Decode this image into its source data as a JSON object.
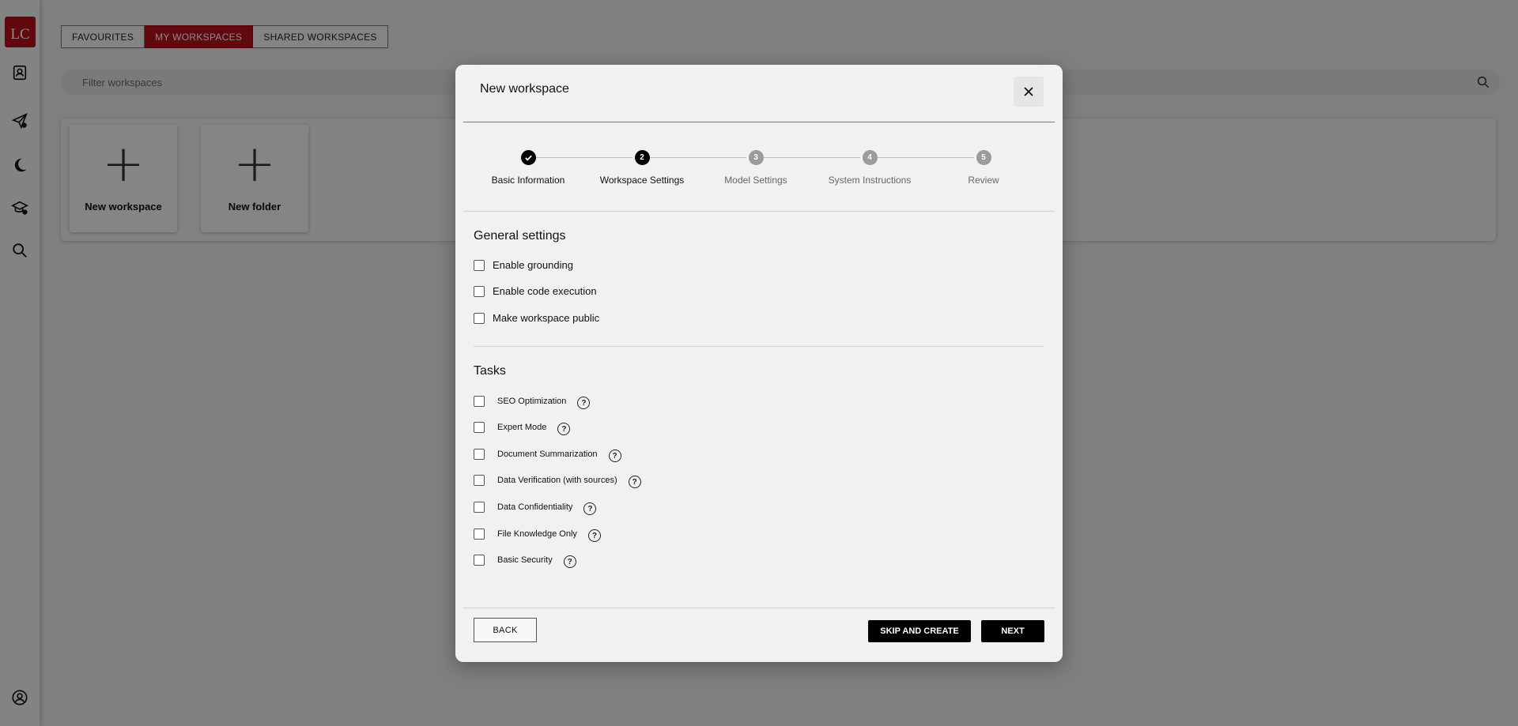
{
  "sidebar": {
    "logo_text": "LC",
    "icons": [
      "profile-card-icon",
      "send-icon",
      "moon-icon",
      "graduation-cap-icon",
      "search-icon",
      "user-account-icon"
    ]
  },
  "tabs": [
    {
      "label": "FAVOURITES",
      "active": false
    },
    {
      "label": "MY WORKSPACES",
      "active": true
    },
    {
      "label": "SHARED WORKSPACES",
      "active": false
    }
  ],
  "filter": {
    "placeholder": "Filter workspaces"
  },
  "cards": [
    {
      "label": "New workspace"
    },
    {
      "label": "New folder"
    }
  ],
  "modal": {
    "title": "New workspace",
    "steps": [
      {
        "number": "1",
        "label": "Basic Information",
        "state": "done"
      },
      {
        "number": "2",
        "label": "Workspace Settings",
        "state": "current"
      },
      {
        "number": "3",
        "label": "Model Settings",
        "state": "pending"
      },
      {
        "number": "4",
        "label": "System Instructions",
        "state": "pending"
      },
      {
        "number": "5",
        "label": "Review",
        "state": "pending"
      }
    ],
    "general": {
      "title": "General settings",
      "options": [
        "Enable grounding",
        "Enable code execution",
        "Make workspace public"
      ]
    },
    "tasks": {
      "title": "Tasks",
      "options": [
        "SEO Optimization",
        "Expert Mode",
        "Document Summarization",
        "Data Verification (with sources)",
        "Data Confidentiality",
        "File Knowledge Only",
        "Basic Security"
      ],
      "help_glyph": "?"
    },
    "buttons": {
      "back": "BACK",
      "skip": "SKIP AND CREATE",
      "next": "NEXT"
    }
  },
  "colors": {
    "brand": "#b3121b",
    "primary_button": "#000000"
  }
}
